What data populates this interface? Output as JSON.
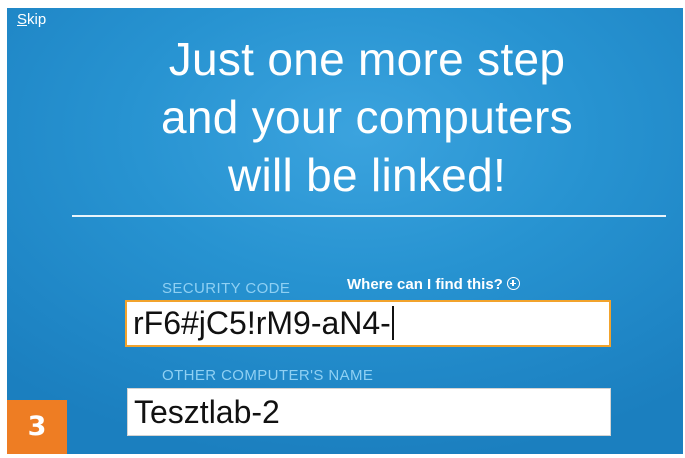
{
  "skip": {
    "accel_letter": "S",
    "rest": "kip"
  },
  "headline": {
    "line1": "Just one more step",
    "line2": "and your computers",
    "line3": "will be linked!"
  },
  "security_code": {
    "label": "SECURITY CODE",
    "help_link": "Where can I find this?",
    "value": "rF6#jC5!rM9-aN4-"
  },
  "other_computer": {
    "label": "OTHER COMPUTER'S NAME",
    "value": "Tesztlab-2"
  },
  "step_badge": "3",
  "colors": {
    "background": "#2793d1",
    "accent_border": "#f2a32c",
    "badge": "#ee7d23",
    "field_label": "#8fd0f3"
  },
  "icons": {
    "help": "circle-plus-icon"
  }
}
